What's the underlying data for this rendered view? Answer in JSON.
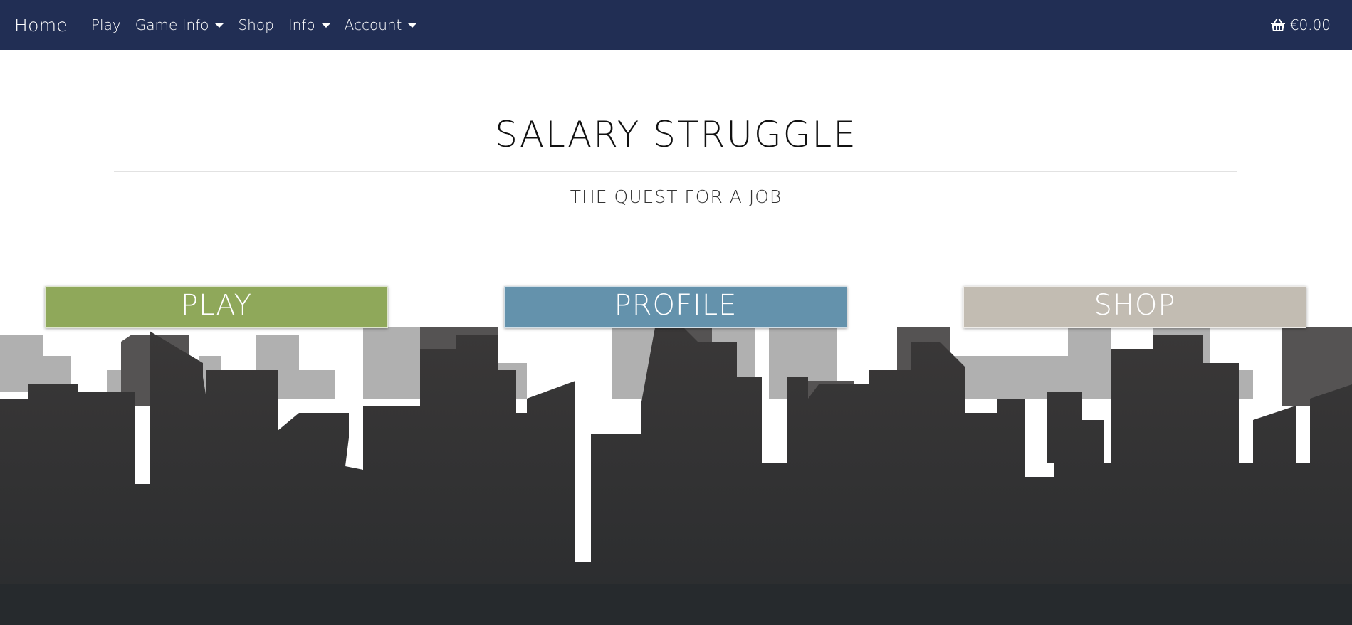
{
  "navbar": {
    "brand": "Home",
    "items": [
      {
        "label": "Play",
        "dropdown": false
      },
      {
        "label": "Game Info",
        "dropdown": true
      },
      {
        "label": "Shop",
        "dropdown": false
      },
      {
        "label": "Info",
        "dropdown": true
      },
      {
        "label": "Account",
        "dropdown": true
      }
    ],
    "cart_total": "€0.00",
    "cart_icon": "basket-icon",
    "background_color": "#212e54"
  },
  "hero": {
    "title": "SALARY STRUGGLE",
    "subtitle": "THE QUEST FOR A JOB"
  },
  "actions": {
    "play_label": "PLAY",
    "profile_label": "PROFILE",
    "shop_label": "SHOP",
    "colors": {
      "play": "#8fa85a",
      "profile": "#6492ac",
      "shop": "#c2bcb2"
    }
  }
}
